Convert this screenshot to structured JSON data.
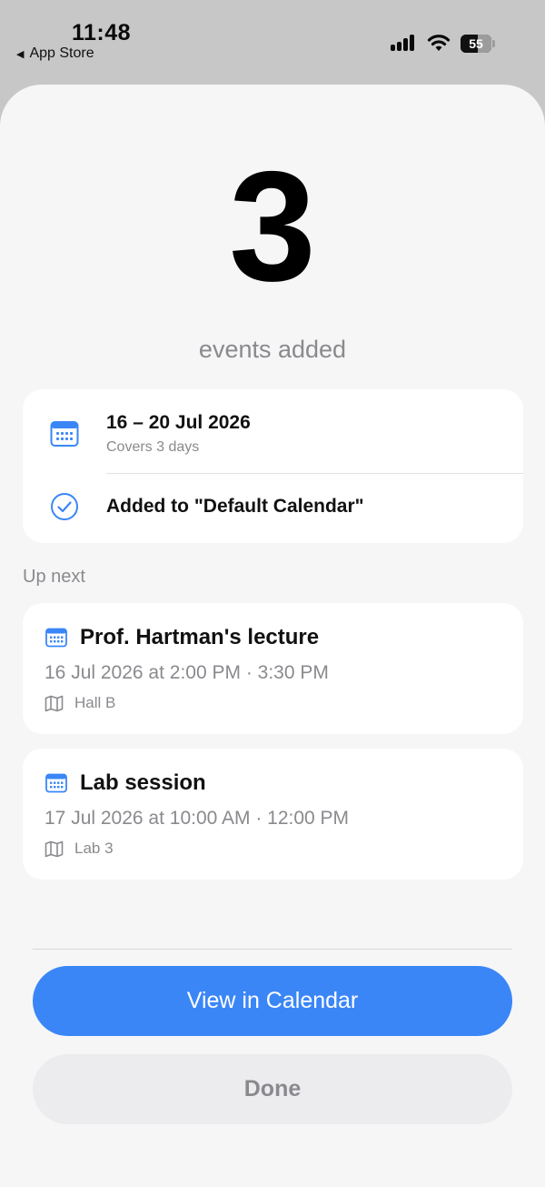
{
  "status_bar": {
    "time": "11:48",
    "back_label": "App Store",
    "battery_level": "55",
    "icons": [
      "cellular-signal-icon",
      "wifi-icon",
      "battery-icon"
    ]
  },
  "summary": {
    "count": "3",
    "count_label": "events added",
    "date_range": "16 – 20 Jul 2026",
    "covers": "Covers 3 days",
    "calendar_added": "Added to \"Default Calendar\""
  },
  "up_next": {
    "label": "Up next",
    "events": [
      {
        "title": "Prof. Hartman's lecture",
        "time": "16 Jul 2026 at 2:00 PM · 3:30 PM",
        "location": "Hall B"
      },
      {
        "title": "Lab session",
        "time": "17 Jul 2026 at 10:00 AM · 12:00 PM",
        "location": "Lab 3"
      }
    ]
  },
  "actions": {
    "primary_label": "View in Calendar",
    "secondary_label": "Done"
  },
  "colors": {
    "accent": "#3a86f7",
    "secondary_text": "#8a8a8e",
    "sheet_background": "#f6f6f7"
  }
}
